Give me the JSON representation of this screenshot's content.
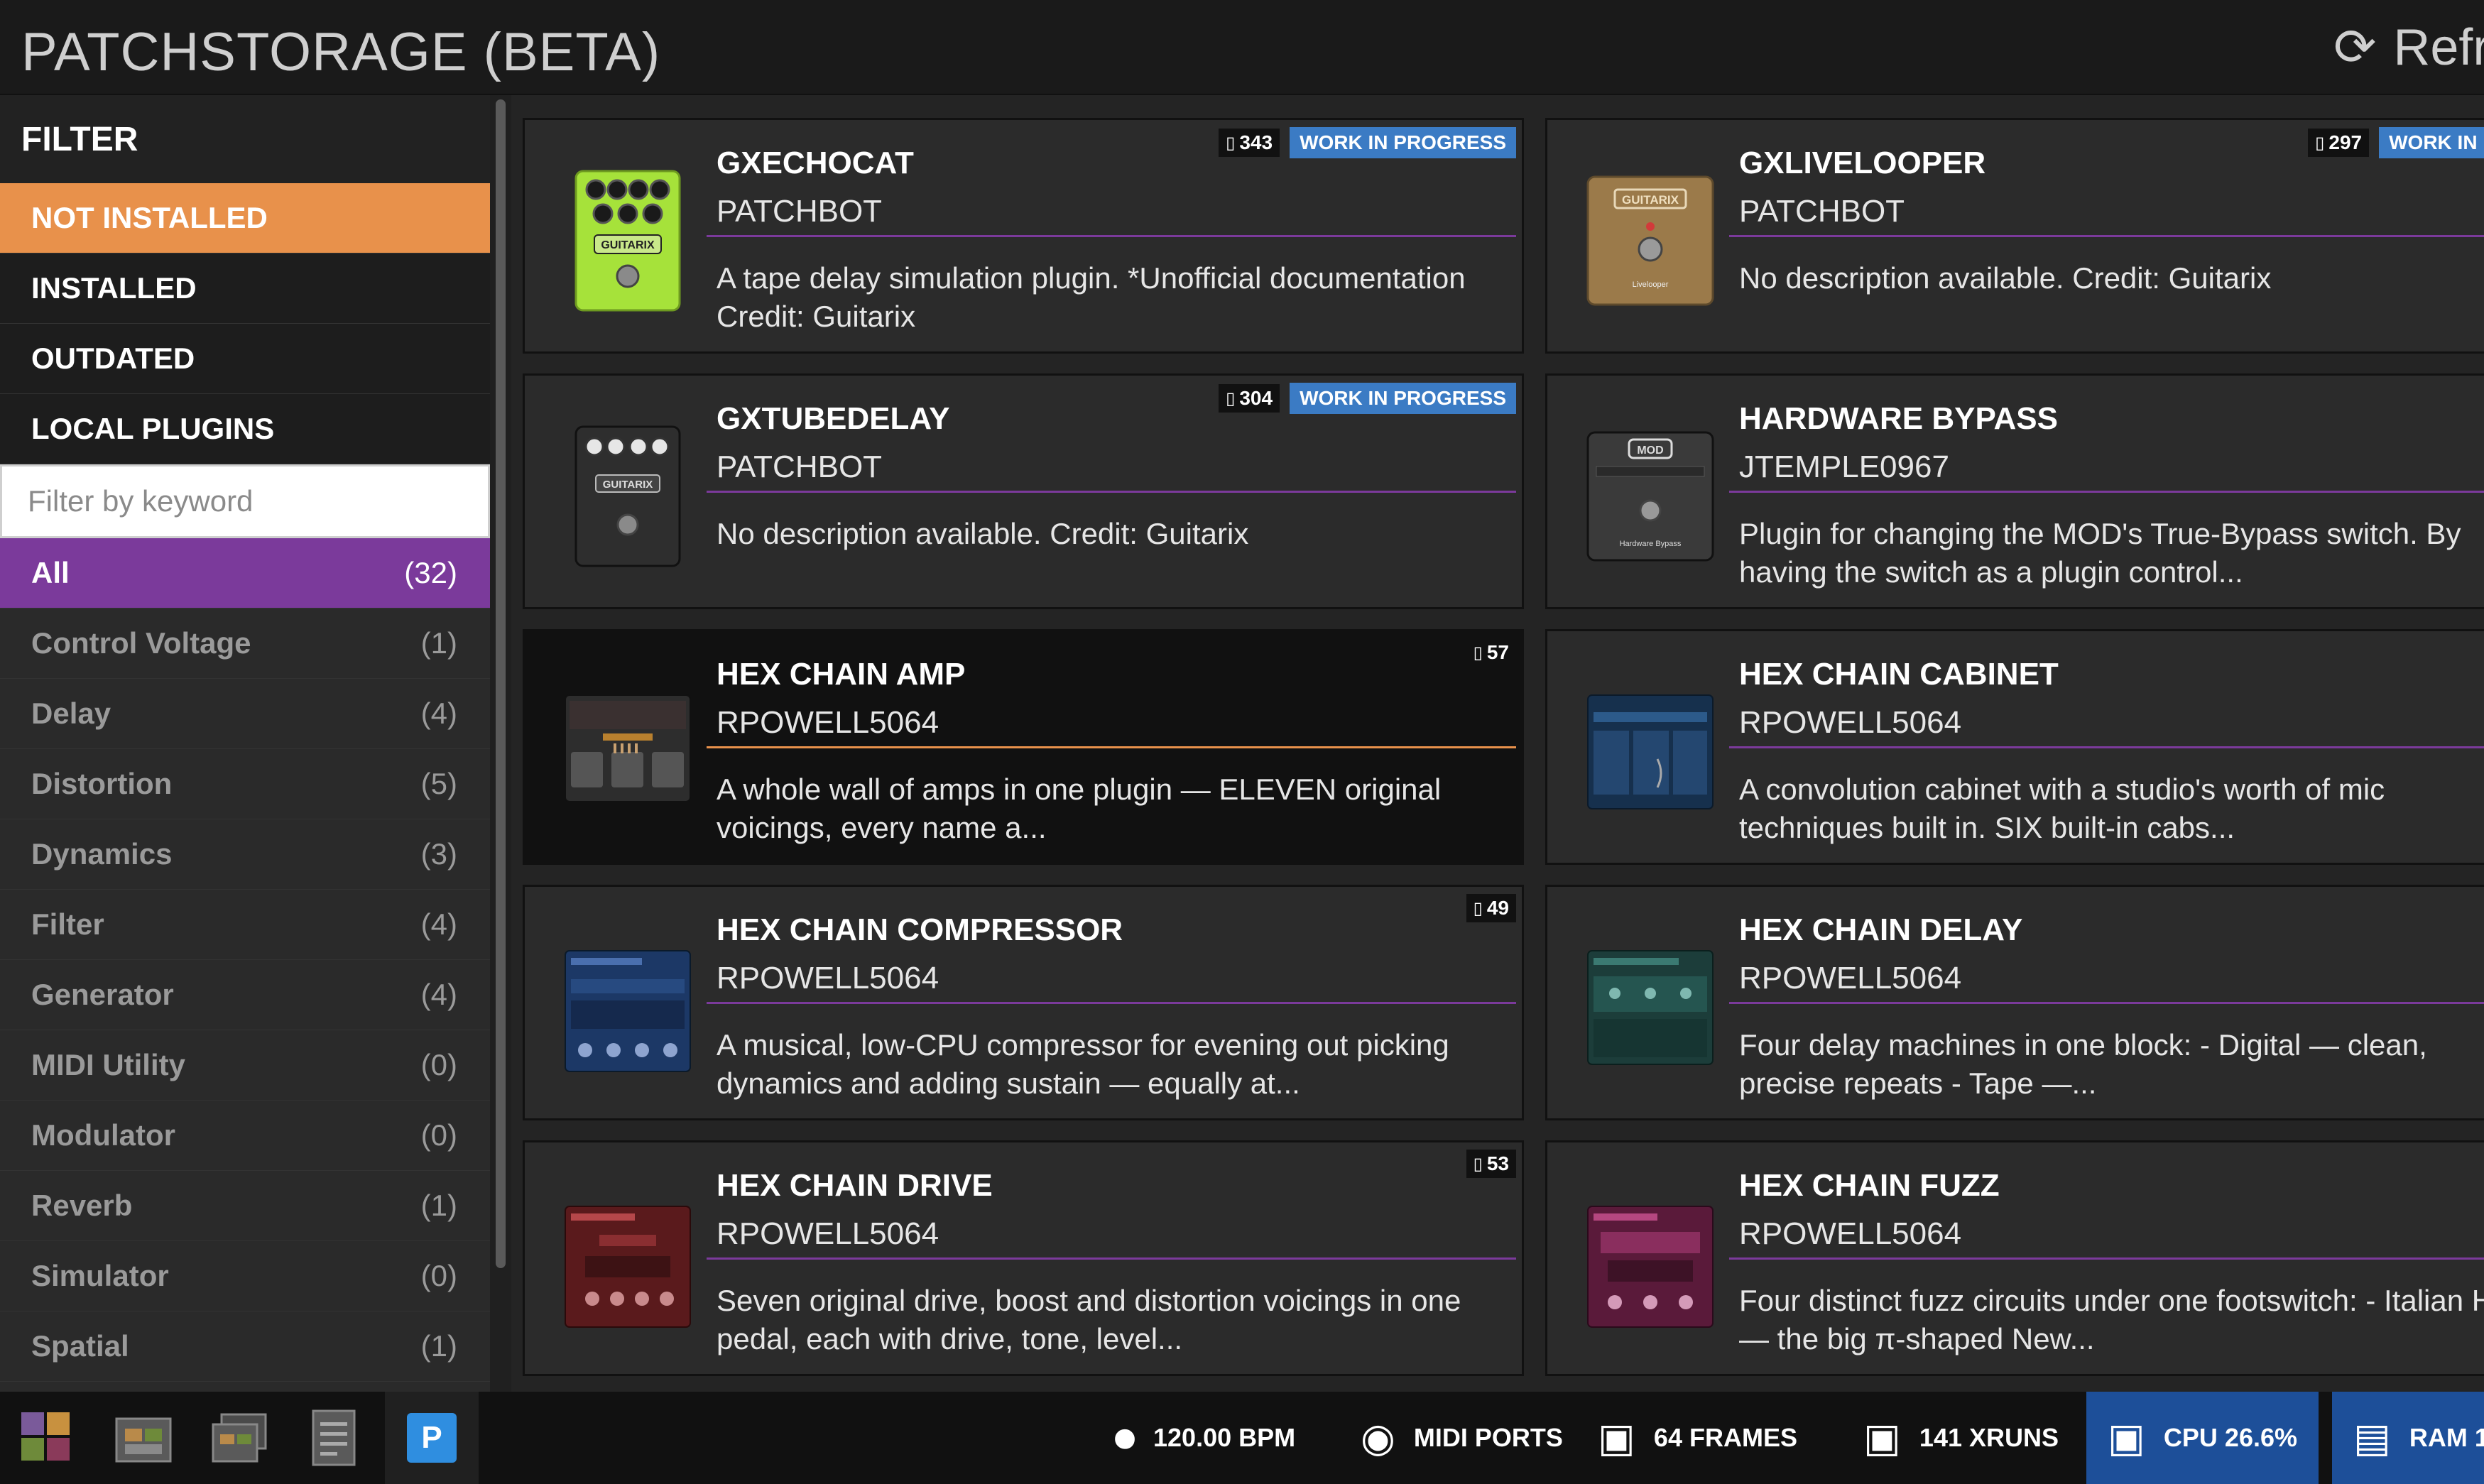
{
  "header": {
    "title": "PATCHSTORAGE (BETA)",
    "refresh_label": "Refre",
    "refresh_icon": "⟳"
  },
  "sidebar": {
    "filter_title": "FILTER",
    "status_items": [
      "NOT INSTALLED",
      "INSTALLED",
      "OUTDATED",
      "LOCAL PLUGINS"
    ],
    "search_placeholder": "Filter by keyword",
    "categories": [
      {
        "label": "All",
        "count": "(32)"
      },
      {
        "label": "Control Voltage",
        "count": "(1)"
      },
      {
        "label": "Delay",
        "count": "(4)"
      },
      {
        "label": "Distortion",
        "count": "(5)"
      },
      {
        "label": "Dynamics",
        "count": "(3)"
      },
      {
        "label": "Filter",
        "count": "(4)"
      },
      {
        "label": "Generator",
        "count": "(4)"
      },
      {
        "label": "MIDI Utility",
        "count": "(0)"
      },
      {
        "label": "Modulator",
        "count": "(0)"
      },
      {
        "label": "Reverb",
        "count": "(1)"
      },
      {
        "label": "Simulator",
        "count": "(0)"
      },
      {
        "label": "Spatial",
        "count": "(1)"
      }
    ]
  },
  "plugins": [
    {
      "title": "GXECHOCAT",
      "author": "PATCHBOT",
      "description": "A tape delay simulation plugin. *Unofficial documentation Credit: Guitarix",
      "downloads": "343",
      "status": "WORK IN PROGRESS"
    },
    {
      "title": "GXLIVELOOPER",
      "author": "PATCHBOT",
      "description": "No description available. Credit: Guitarix",
      "downloads": "297",
      "status": "WORK IN PROGR"
    },
    {
      "title": "GXTUBEDELAY",
      "author": "PATCHBOT",
      "description": "No description available. Credit: Guitarix",
      "downloads": "304",
      "status": "WORK IN PROGRESS"
    },
    {
      "title": "HARDWARE BYPASS",
      "author": "JTEMPLE0967",
      "description": "Plugin for changing the MOD's True-Bypass switch. By having the switch as a plugin control..."
    },
    {
      "title": "HEX CHAIN AMP",
      "author": "RPOWELL5064",
      "description": "A whole wall of amps in one plugin — ELEVEN original voicings, every name a...",
      "downloads": "57"
    },
    {
      "title": "HEX CHAIN CABINET",
      "author": "RPOWELL5064",
      "description": "A convolution cabinet with a studio's worth of mic techniques built in. SIX built-in cabs..."
    },
    {
      "title": "HEX CHAIN COMPRESSOR",
      "author": "RPOWELL5064",
      "description": "A musical, low-CPU compressor for evening out picking dynamics and adding sustain — equally at...",
      "downloads": "49"
    },
    {
      "title": "HEX CHAIN DELAY",
      "author": "RPOWELL5064",
      "description": "Four delay machines in one block: - Digital — clean, precise repeats - Tape —..."
    },
    {
      "title": "HEX CHAIN DRIVE",
      "author": "RPOWELL5064",
      "description": "Seven original drive, boost and distortion voicings in one pedal, each with drive, tone, level...",
      "downloads": "53"
    },
    {
      "title": "HEX CHAIN FUZZ",
      "author": "RPOWELL5064",
      "description": "Four distinct fuzz circuits under one footswitch: - Italian He — the big π-shaped New..."
    }
  ],
  "thumb_labels": {
    "echocat": "GUITARIX",
    "looper": "GUITARIX",
    "looper_name": "Livelooper",
    "tubedelay": "GUITARIX",
    "bypass": "MOD",
    "bypass_name": "Hardware Bypass"
  },
  "footer": {
    "bpm": "120.00 BPM",
    "midi": "MIDI PORTS",
    "frames": "64 FRAMES",
    "xruns": "141 XRUNS",
    "cpu": "CPU 26.6%",
    "ram": "RAM 1",
    "tab_p": "P"
  },
  "colors": {
    "accent_orange": "#e8914b",
    "accent_purple": "#7b3a9b",
    "badge_blue": "#3b7bc4",
    "stat_highlight": "#1d4f99"
  }
}
